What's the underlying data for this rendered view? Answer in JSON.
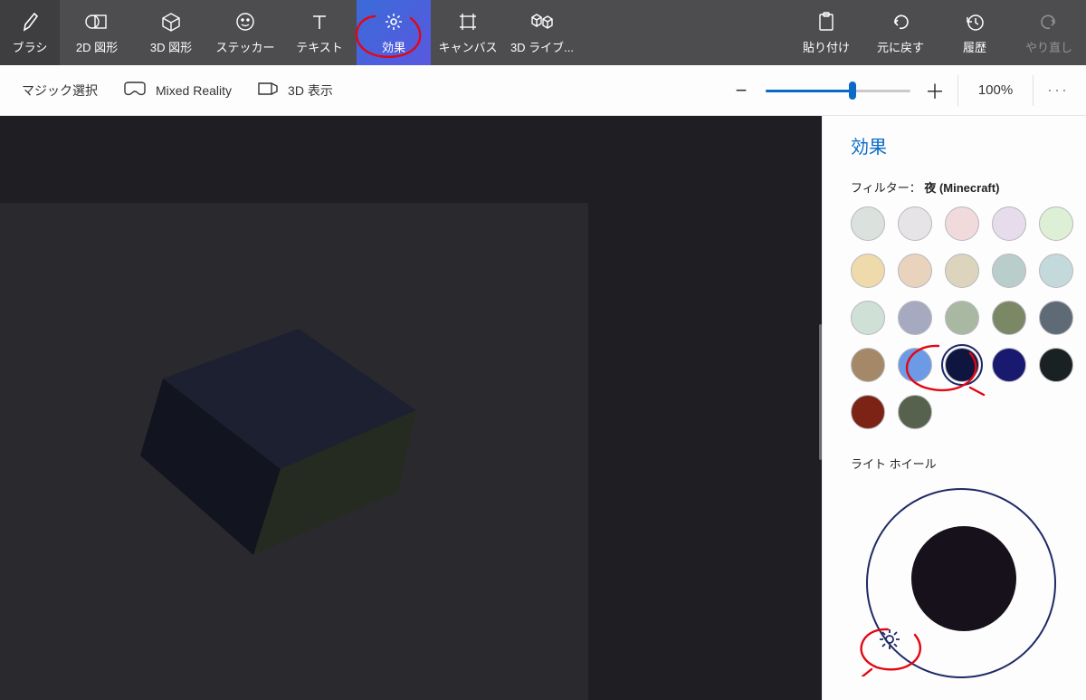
{
  "toolbar": {
    "brush": "ブラシ",
    "shapes2d": "2D 図形",
    "shapes3d": "3D 図形",
    "sticker": "ステッカー",
    "text": "テキスト",
    "effects": "効果",
    "canvas": "キャンバス",
    "library3d": "3D ライブ...",
    "paste": "貼り付け",
    "undo": "元に戻す",
    "history": "履歴",
    "redo": "やり直し"
  },
  "subbar": {
    "magic_select": "マジック選択",
    "mixed_reality": "Mixed Reality",
    "view3d": "3D 表示",
    "zoom_pct": "100%",
    "zoom_pos_pct": 60
  },
  "panel": {
    "title": "効果",
    "filter_prefix": "フィルター： ",
    "filter_name": "夜 (Minecraft)",
    "light_wheel": "ライト ホイール",
    "swatches": [
      "#dbe2dd",
      "#e6e4e7",
      "#f1dadb",
      "#e6dcec",
      "#ddf0d5",
      "#eedaaa",
      "#e9d3bd",
      "#dcd4bd",
      "#b9ceca",
      "#c4d9dc",
      "#cfe0d6",
      "#a6aac0",
      "#a9b8a2",
      "#7b8866",
      "#5f6a77",
      "#a58867",
      "#6d9ae5",
      "#0e1640",
      "#191970",
      "#1a2122",
      "#7c2316",
      "#56624d"
    ],
    "selected_swatch_index": 17
  }
}
